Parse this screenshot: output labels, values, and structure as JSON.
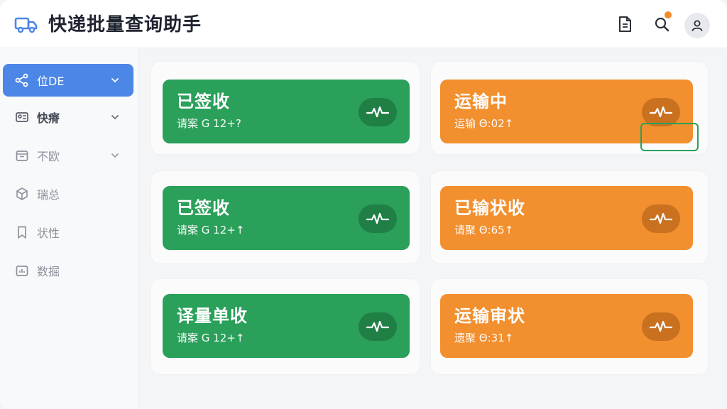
{
  "header": {
    "title": "快递批量查询助手",
    "icons": {
      "logo": "truck-icon",
      "doc": "document-icon",
      "search": "search-icon",
      "user": "user-icon"
    },
    "accent": "#4c86e6"
  },
  "sidebar": {
    "items": [
      {
        "label": "位DE",
        "icon": "share-icon",
        "chevron": true,
        "state": "active"
      },
      {
        "label": "快瘠",
        "icon": "id-card-icon",
        "chevron": true,
        "state": "normal"
      },
      {
        "label": "不欧",
        "icon": "calendar-icon",
        "chevron": true,
        "state": "dim"
      },
      {
        "label": "瑞总",
        "icon": "cube-icon",
        "chevron": false,
        "state": "dim"
      },
      {
        "label": "状性",
        "icon": "bookmark-icon",
        "chevron": false,
        "state": "dim"
      },
      {
        "label": "数掘",
        "icon": "chart-icon",
        "chevron": false,
        "state": "dim"
      }
    ]
  },
  "cards": [
    {
      "title": "已签收",
      "subtitle": "请案 G 12+?",
      "color": "green",
      "icon": "pulse-icon"
    },
    {
      "title": "运输中",
      "subtitle": "运输 Θ:02↑",
      "color": "orange",
      "icon": "pulse-icon"
    },
    {
      "title": "已签收",
      "subtitle": "请案 G 12+↑",
      "color": "green",
      "icon": "pulse-icon"
    },
    {
      "title": "已输状收",
      "subtitle": "请聚 Θ:65↑",
      "color": "orange",
      "icon": "pulse-icon"
    },
    {
      "title": "译量单收",
      "subtitle": "请案 G 12+↑",
      "color": "green",
      "icon": "pulse-icon"
    },
    {
      "title": "运输审状",
      "subtitle": "遗聚 Θ:31↑",
      "color": "orange",
      "icon": "pulse-icon"
    }
  ],
  "colors": {
    "green": "#2aa05a",
    "orange": "#f28f2e",
    "notify": "#f28b2c"
  }
}
